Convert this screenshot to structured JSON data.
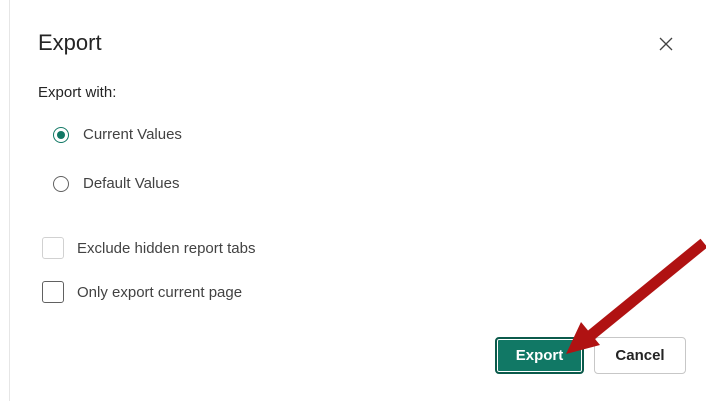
{
  "dialog": {
    "title": "Export",
    "close_icon": "close-icon"
  },
  "export_with": {
    "label": "Export with:",
    "options": [
      {
        "label": "Current Values",
        "selected": true
      },
      {
        "label": "Default Values",
        "selected": false
      }
    ]
  },
  "checkboxes": [
    {
      "label": "Exclude hidden report tabs",
      "checked": false,
      "disabled": true
    },
    {
      "label": "Only export current page",
      "checked": false,
      "disabled": false
    }
  ],
  "buttons": {
    "export_label": "Export",
    "cancel_label": "Cancel"
  },
  "colors": {
    "accent": "#117865",
    "annotation_arrow": "#b01212"
  }
}
